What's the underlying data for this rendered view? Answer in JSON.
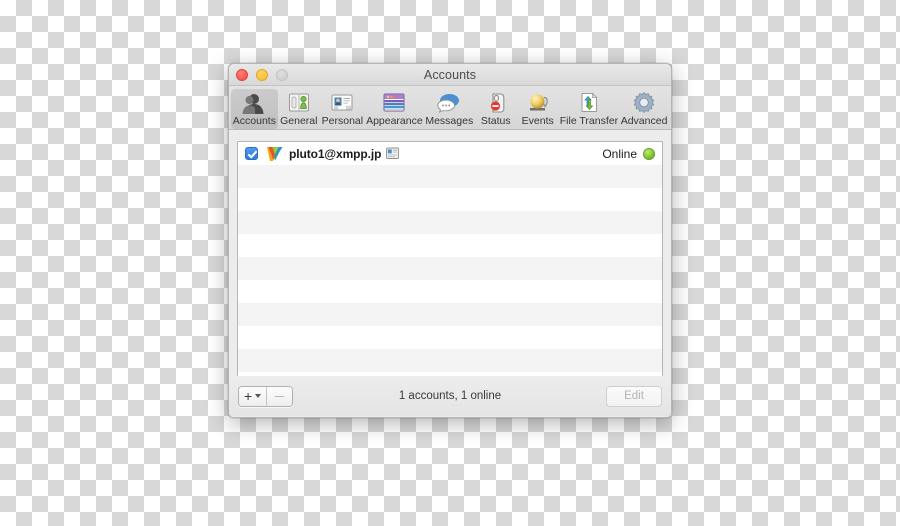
{
  "window": {
    "title": "Accounts",
    "traffic_lights": [
      {
        "name": "close",
        "label": "Close"
      },
      {
        "name": "minimize",
        "label": "Minimize"
      },
      {
        "name": "zoom",
        "label": "Zoom"
      }
    ]
  },
  "toolbar": {
    "items": [
      {
        "label": "Accounts",
        "icon": "accounts-icon",
        "selected": true
      },
      {
        "label": "General",
        "icon": "general-icon",
        "selected": false
      },
      {
        "label": "Personal",
        "icon": "personal-icon",
        "selected": false
      },
      {
        "label": "Appearance",
        "icon": "appearance-icon",
        "selected": false
      },
      {
        "label": "Messages",
        "icon": "messages-icon",
        "selected": false
      },
      {
        "label": "Status",
        "icon": "status-icon",
        "selected": false
      },
      {
        "label": "Events",
        "icon": "events-icon",
        "selected": false
      },
      {
        "label": "File Transfer",
        "icon": "file-transfer-icon",
        "selected": false
      },
      {
        "label": "Advanced",
        "icon": "advanced-icon",
        "selected": false
      }
    ]
  },
  "accounts_list": {
    "rows": [
      {
        "enabled": true,
        "icon": "jabber-account-icon",
        "name": "pluto1@xmpp.jp",
        "badge": "vcard-badge-icon",
        "status": "Online",
        "status_color": "#8fcf3a"
      }
    ],
    "empty_row_count": 9
  },
  "bottom_bar": {
    "add_label": "+",
    "remove_label": "−",
    "count_text": "1 accounts, 1 online",
    "edit_label": "Edit",
    "edit_enabled": false
  },
  "colors": {
    "selection_blue": "#2b7de0",
    "online_green": "#8fcf3a",
    "window_chrome": "#ececec"
  }
}
